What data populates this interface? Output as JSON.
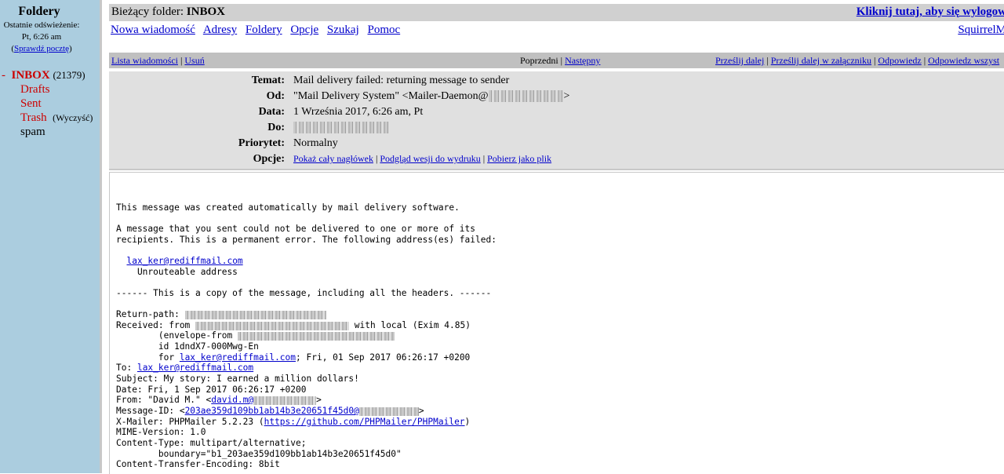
{
  "sidebar": {
    "title": "Foldery",
    "last_refresh_label": "Ostatnie odświeżenie:",
    "last_refresh_time": "Pt, 6:26 am",
    "check_mail": "(Sprawdź pocztę)",
    "check_mail_link": "Sprawdź pocztę",
    "folders": [
      {
        "name": "INBOX",
        "count": "(21379)"
      },
      {
        "name": "Drafts"
      },
      {
        "name": "Sent"
      },
      {
        "name": "Trash",
        "action": "(Wyczyść)"
      },
      {
        "name": "spam"
      }
    ]
  },
  "topbar": {
    "current_folder_label": "Bieżący folder:",
    "current_folder": "INBOX",
    "logout": "Kliknij tutaj, aby się wylogow"
  },
  "nav": {
    "items": [
      "Nowa wiadomość",
      "Adresy",
      "Foldery",
      "Opcje",
      "Szukaj",
      "Pomoc"
    ],
    "brand": "SquirrelM"
  },
  "msgbar": {
    "list": "Lista wiadomości",
    "delete": "Usuń",
    "prev": "Poprzedni",
    "next": "Następny",
    "forward": "Prześlij dalej",
    "forward_attach": "Prześlij dalej w załączniku",
    "reply": "Odpowiedz",
    "reply_all": "Odpowiedz wszyst"
  },
  "headers": {
    "subject_label": "Temat:",
    "subject": "Mail delivery failed: returning message to sender",
    "from_label": "Od:",
    "from_prefix": "\"Mail Delivery System\" <Mailer-Daemon@",
    "from_suffix": ">",
    "date_label": "Data:",
    "date": "1 Września 2017, 6:26 am, Pt",
    "to_label": "Do:",
    "priority_label": "Priorytet:",
    "priority": "Normalny",
    "options_label": "Opcje:",
    "option_links": [
      "Pokaż cały nagłówek",
      "Podgląd wesji do wydruku",
      "Pobierz jako plik"
    ]
  },
  "body": {
    "line1": "This message was created automatically by mail delivery software.",
    "line2": "A message that you sent could not be delivered to one or more of its",
    "line3": "recipients. This is a permanent error. The following address(es) failed:",
    "failed_address": "lax_ker@rediffmail.com",
    "unroutable": "    Unrouteable address",
    "copy_line": "------ This is a copy of the message, including all the headers. ------",
    "return_path": "Return-path: ",
    "received": "Received: from ",
    "received_tail": " with local (Exim 4.85)",
    "envelope": "        (envelope-from ",
    "id_line": "        id 1dndX7-000Mwg-En",
    "for_prefix": "        for ",
    "for_address": "lax_ker@rediffmail.com",
    "for_suffix": "; Fri, 01 Sep 2017 06:26:17 +0200",
    "to_prefix": "To: ",
    "to_address": "lax_ker@rediffmail.com",
    "subject_line": "Subject: My story: I earned a million dollars!",
    "date_line": "Date: Fri, 1 Sep 2017 06:26:17 +0200",
    "from_line_prefix": "From: \"David M.\" <",
    "from_line_link": "david.m@",
    "from_line_suffix": ">",
    "msgid_prefix": "Message-ID: <",
    "msgid_link": "203ae359d109bb1ab14b3e20651f45d0@",
    "msgid_suffix": ">",
    "xmailer_prefix": "X-Mailer: PHPMailer 5.2.23 (",
    "xmailer_link": "https://github.com/PHPMailer/PHPMailer",
    "xmailer_suffix": ")",
    "mime": "MIME-Version: 1.0",
    "content_type": "Content-Type: multipart/alternative;",
    "boundary": "        boundary=\"b1_203ae359d109bb1ab14b3e20651f45d0\"",
    "cte": "Content-Transfer-Encoding: 8bit"
  }
}
